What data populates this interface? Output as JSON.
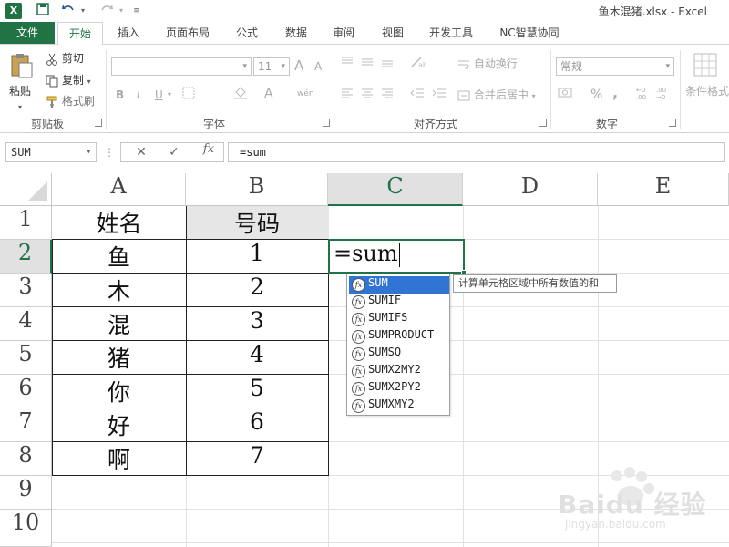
{
  "window": {
    "title": "鱼木混猪.xlsx - Excel",
    "app_icon": "X"
  },
  "quick_access": {
    "icons": [
      "save-icon",
      "undo-icon",
      "redo-icon",
      "customize-icon"
    ]
  },
  "tabs": {
    "file": "文件",
    "items": [
      "开始",
      "插入",
      "页面布局",
      "公式",
      "数据",
      "审阅",
      "视图",
      "开发工具",
      "NC智慧协同"
    ],
    "active": "开始"
  },
  "ribbon": {
    "clipboard": {
      "paste": "粘贴",
      "cut": "剪切",
      "copy": "复制",
      "format_painter": "格式刷",
      "label": "剪贴板"
    },
    "font": {
      "font_name": "",
      "font_size": "11",
      "grow": "A",
      "shrink": "A",
      "bold": "B",
      "italic": "I",
      "underline": "U",
      "phonetic": "wén",
      "label": "字体"
    },
    "alignment": {
      "wrap_text": "自动换行",
      "merge_center": "合并后居中",
      "label": "对齐方式"
    },
    "number": {
      "format": "常规",
      "percent": "%",
      "comma": ",",
      "inc_decimal": ".00→.0",
      "dec_decimal": ".00→.0",
      "label": "数字"
    },
    "styles": {
      "conditional": "条件格式"
    }
  },
  "formula_bar": {
    "name_box": "SUM",
    "fx": "fx",
    "formula": "=sum"
  },
  "sheet": {
    "columns": [
      "A",
      "B",
      "C",
      "D",
      "E"
    ],
    "rows": [
      "1",
      "2",
      "3",
      "4",
      "5",
      "6",
      "7",
      "8",
      "9",
      "10"
    ],
    "selected_column": "C",
    "selected_row": "2",
    "headers": {
      "a1": "姓名",
      "b1": "号码"
    },
    "data": [
      {
        "name": "鱼",
        "number": "1"
      },
      {
        "name": "木",
        "number": "2"
      },
      {
        "name": "混",
        "number": "3"
      },
      {
        "name": "猪",
        "number": "4"
      },
      {
        "name": "你",
        "number": "5"
      },
      {
        "name": "好",
        "number": "6"
      },
      {
        "name": "啊",
        "number": "7"
      }
    ],
    "active_cell_text": "=sum"
  },
  "autocomplete": {
    "items": [
      "SUM",
      "SUMIF",
      "SUMIFS",
      "SUMPRODUCT",
      "SUMSQ",
      "SUMX2MY2",
      "SUMX2PY2",
      "SUMXMY2"
    ],
    "selected_index": 0,
    "tooltip": "计算单元格区域中所有数值的和"
  },
  "watermark": {
    "brand": "Baidu 经验",
    "url": "jingyan.baidu.com"
  },
  "colors": {
    "excel_green": "#217346",
    "selection_blue": "#3074d4",
    "header_fill": "#e6e6e6"
  }
}
